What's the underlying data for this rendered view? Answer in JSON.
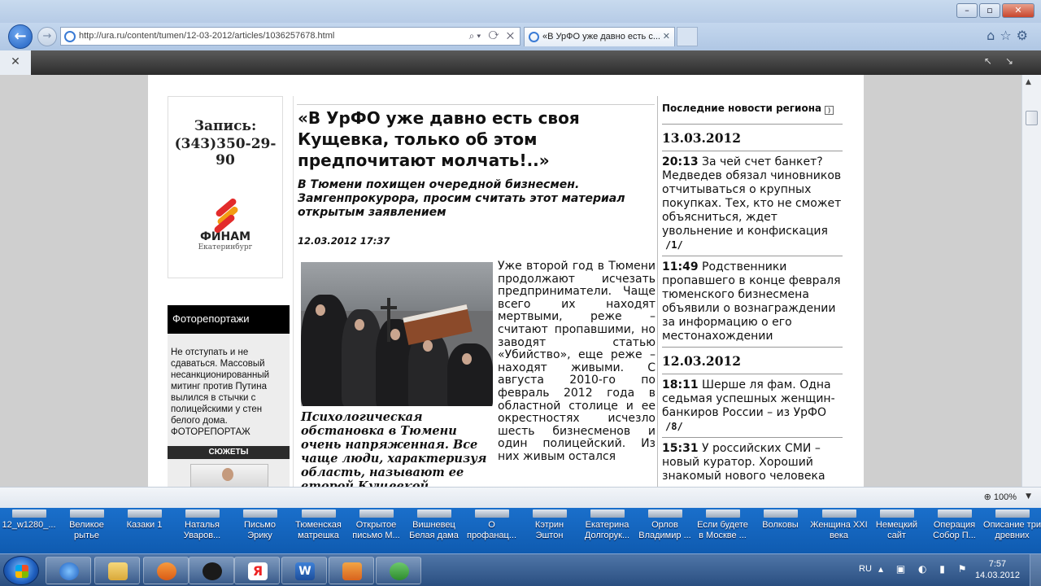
{
  "browser": {
    "url": "http://ura.ru/content/tumen/12-03-2012/articles/1036257678.html",
    "tab_title": "«В УрФО уже давно есть с...",
    "zoom": "100%"
  },
  "ad": {
    "line1": "Запись:",
    "line2": "(343)350-29-90",
    "brand": "ФИНАМ",
    "city": "Екатеринбург"
  },
  "sidebar": {
    "photo_header": "Фоторепортажи",
    "photo_text": "Не отступать и не сдаваться. Массовый несанкционированный митинг против Путина вылился в стычки с полицейскими у стен белого дома. ФОТОРЕПОРТАЖ",
    "stories_header": "СЮЖЕТЫ"
  },
  "article": {
    "title": "«В УрФО уже давно есть своя Кущевка, только об этом предпочитают молчать!..»",
    "lead": "В Тюмени похищен очередной бизнесмен. Замгенпрокурора, просим считать этот материал открытым заявлением",
    "date": "12.03.2012 17:37",
    "caption": "Психологическая обстановка в Тюмени очень напряженная. Все чаще люди, характеризуя область, называют ее второй Кущевкой",
    "body": "Уже второй год в Тюмени продолжают исчезать предприниматели. Чаще всего их находят мертвыми, реже – считают пропавшими, но заводят статью «Убийство», еще реже – находят живыми. С августа 2010-го по февраль 2012 года в областной столице и ее окрестностях исчезло шесть бизнесменов и один полицейский. Из них живым остался"
  },
  "news": {
    "header": "Последние новости региона",
    "date1": "13.03.2012",
    "items1": [
      {
        "time": "20:13",
        "text": "За чей счет банкет? Медведев обязал чиновников отчитываться о крупных покупках. Тех, кто не сможет объясниться, ждет увольнение и конфискация",
        "count": "/1/"
      },
      {
        "time": "11:49",
        "text": "Родственники пропавшего в конце февраля тюменского бизнесмена объявили о вознаграждении за информацию о его местонахождении",
        "count": ""
      }
    ],
    "date2": "12.03.2012",
    "items2": [
      {
        "time": "18:11",
        "text": "Шерше ля фам. Одна седьмая успешных женщин-банкиров России – из УрФО",
        "count": "/8/"
      },
      {
        "time": "15:31",
        "text": "У российских СМИ – новый куратор. Хороший знакомый нового человека",
        "count": ""
      }
    ]
  },
  "desktop_items": [
    {
      "label": "12_w1280_..."
    },
    {
      "label": "Великое рытье"
    },
    {
      "label": "Казаки 1"
    },
    {
      "label": "Наталья Уваров..."
    },
    {
      "label": "Письмо Эрику"
    },
    {
      "label": "Тюменская матрешка"
    },
    {
      "label": "Открытое письмо М..."
    },
    {
      "label": "Вишневец Белая дама"
    },
    {
      "label": "О профанац..."
    },
    {
      "label": "Кэтрин Эштон"
    },
    {
      "label": "Екатерина Долгорук..."
    },
    {
      "label": "Орлов Владимир ..."
    },
    {
      "label": "Если будете в Москве ..."
    },
    {
      "label": "Волковы"
    },
    {
      "label": "Женщина XXI века"
    },
    {
      "label": "Немецкий сайт"
    },
    {
      "label": "Операция Собор П..."
    },
    {
      "label": "Описание три древних"
    }
  ],
  "tray": {
    "lang": "RU",
    "time": "7:57",
    "date": "14.03.2012"
  },
  "colors": {
    "taskbar": "#2a4e80",
    "desktop_strip": "#1a6fcb",
    "finam_red": "#e32b2b",
    "finam_orange": "#f39c12"
  }
}
